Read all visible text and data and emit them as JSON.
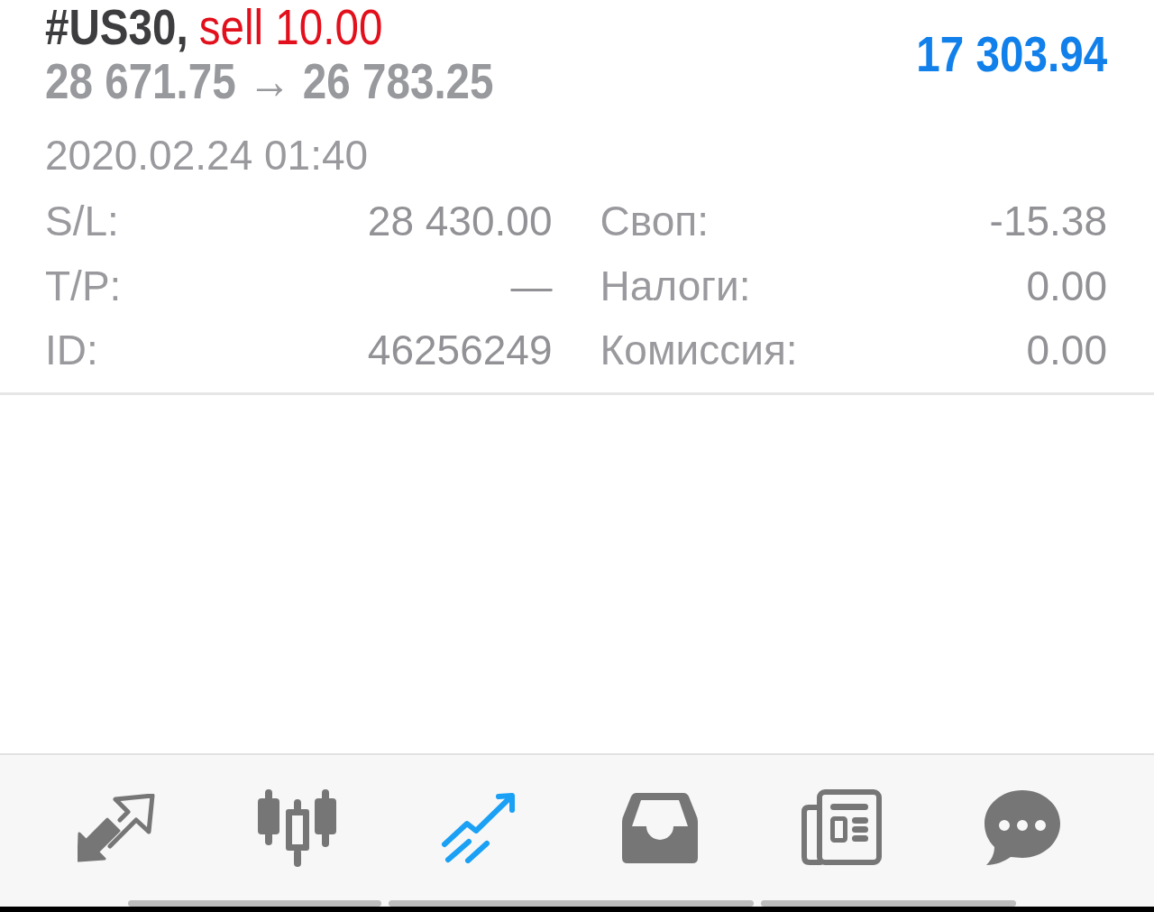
{
  "position": {
    "symbol": "#US30,",
    "order": "sell 10.00",
    "order_sell": true,
    "prices": "28 671.75 → 26 783.25",
    "profit": "17 303.94",
    "profit_loss": false,
    "time": "2020.02.24 01:40"
  },
  "details": [
    {
      "label": "S/L:",
      "value": "28 430.00"
    },
    {
      "label": "Своп:",
      "value": "-15.38"
    },
    {
      "label": "T/P:",
      "value": "—"
    },
    {
      "label": "Налоги:",
      "value": "0.00"
    },
    {
      "label": "ID:",
      "value": "46256249"
    },
    {
      "label": "Комиссия:",
      "value": "0.00"
    }
  ],
  "tabs": [
    {
      "kind": "quotes",
      "selected": false
    },
    {
      "kind": "chart",
      "selected": false
    },
    {
      "kind": "trade",
      "selected": true
    },
    {
      "kind": "history",
      "selected": false
    },
    {
      "kind": "news",
      "selected": false
    },
    {
      "kind": "chat",
      "selected": false
    }
  ]
}
